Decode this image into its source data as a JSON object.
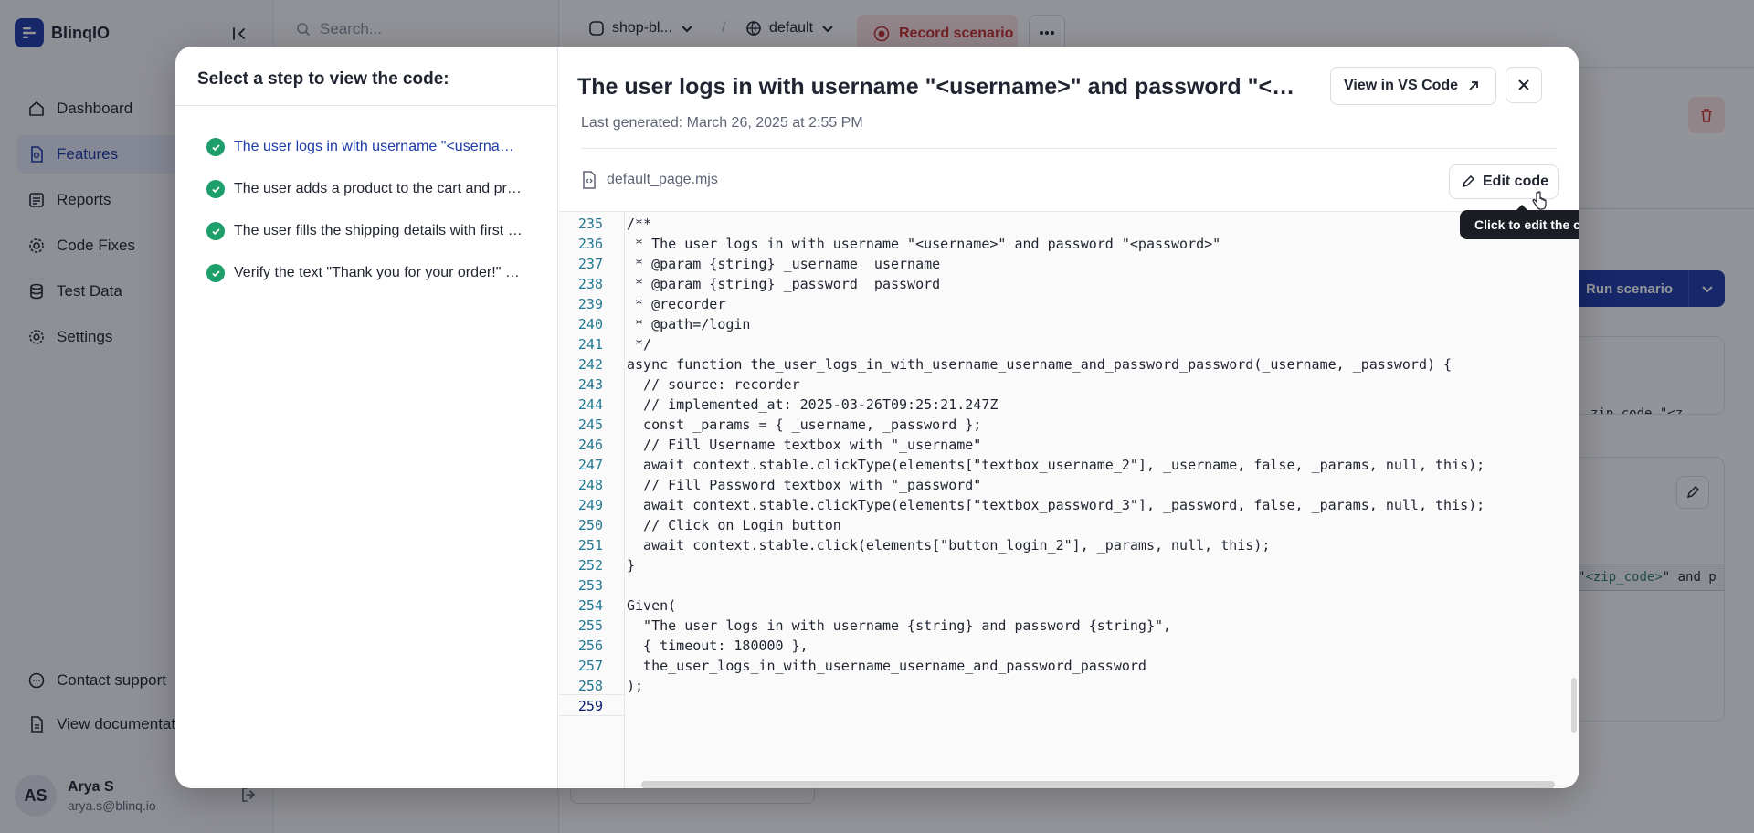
{
  "brand": {
    "name": "BlinqIO"
  },
  "search": {
    "placeholder": "Search..."
  },
  "sidebar": {
    "items": [
      {
        "label": "Dashboard",
        "icon": "home-icon"
      },
      {
        "label": "Features",
        "icon": "features-icon",
        "active": true
      },
      {
        "label": "Reports",
        "icon": "reports-icon"
      },
      {
        "label": "Code Fixes",
        "icon": "code-fixes-icon"
      },
      {
        "label": "Test Data",
        "icon": "database-icon"
      },
      {
        "label": "Settings",
        "icon": "gear-icon"
      }
    ],
    "bottom": [
      {
        "label": "Contact support",
        "icon": "chat-icon"
      },
      {
        "label": "View documentation",
        "icon": "doc-icon"
      }
    ],
    "user": {
      "initials": "AS",
      "name": "Arya S",
      "email": "arya.s@blinq.io"
    }
  },
  "topbar": {
    "project": "shop-bl...",
    "separator": "/",
    "environment": "default",
    "record_label": "Record scenario"
  },
  "background": {
    "run_label": "Run scenario",
    "card_snippet": "zip code \"<z…",
    "code_snippet_prefix": "\"",
    "code_snippet_token": "<zip_code>",
    "code_snippet_suffix": "\" and p"
  },
  "modal": {
    "steps_title": "Select a step to view the code:",
    "steps": [
      {
        "text": "The user logs in with username \"<username>\" and password \"<password>\"",
        "active": true
      },
      {
        "text": "The user adds a product to the cart and proceeds to checkout",
        "active": false
      },
      {
        "text": "The user fills the shipping details with first name, last name and zip code",
        "active": false
      },
      {
        "text": "Verify the text \"Thank you for your order!\" is displayed",
        "active": false
      }
    ],
    "title": "The user logs in with username \"<username>\" and password \"<password>\"",
    "last_generated": "Last generated: March 26, 2025 at 2:55 PM",
    "vscode_label": "View in VS Code",
    "file_name": "default_page.mjs",
    "edit_label": "Edit code",
    "edit_tooltip": "Click to edit the code",
    "code_lines": [
      {
        "n": "235",
        "t": "/**"
      },
      {
        "n": "236",
        "t": " * The user logs in with username \"<username>\" and password \"<password>\""
      },
      {
        "n": "237",
        "t": " * @param {string} _username  username"
      },
      {
        "n": "238",
        "t": " * @param {string} _password  password"
      },
      {
        "n": "239",
        "t": " * @recorder"
      },
      {
        "n": "240",
        "t": " * @path=/login"
      },
      {
        "n": "241",
        "t": " */"
      },
      {
        "n": "242",
        "t": "async function the_user_logs_in_with_username_username_and_password_password(_username, _password) {"
      },
      {
        "n": "243",
        "t": "  // source: recorder"
      },
      {
        "n": "244",
        "t": "  // implemented_at: 2025-03-26T09:25:21.247Z"
      },
      {
        "n": "245",
        "t": "  const _params = { _username, _password };"
      },
      {
        "n": "246",
        "t": "  // Fill Username textbox with \"_username\""
      },
      {
        "n": "247",
        "t": "  await context.stable.clickType(elements[\"textbox_username_2\"], _username, false, _params, null, this);"
      },
      {
        "n": "248",
        "t": "  // Fill Password textbox with \"_password\""
      },
      {
        "n": "249",
        "t": "  await context.stable.clickType(elements[\"textbox_password_3\"], _password, false, _params, null, this);"
      },
      {
        "n": "250",
        "t": "  // Click on Login button"
      },
      {
        "n": "251",
        "t": "  await context.stable.click(elements[\"button_login_2\"], _params, null, this);"
      },
      {
        "n": "252",
        "t": "}"
      },
      {
        "n": "253",
        "t": ""
      },
      {
        "n": "254",
        "t": "Given("
      },
      {
        "n": "255",
        "t": "  \"The user logs in with username {string} and password {string}\","
      },
      {
        "n": "256",
        "t": "  { timeout: 180000 },"
      },
      {
        "n": "257",
        "t": "  the_user_logs_in_with_username_username_and_password_password"
      },
      {
        "n": "258",
        "t": ");"
      },
      {
        "n": "259",
        "t": ""
      }
    ]
  },
  "colors": {
    "brand": "#1c3aa9",
    "success": "#1e9e6a",
    "danger": "#c53030"
  }
}
